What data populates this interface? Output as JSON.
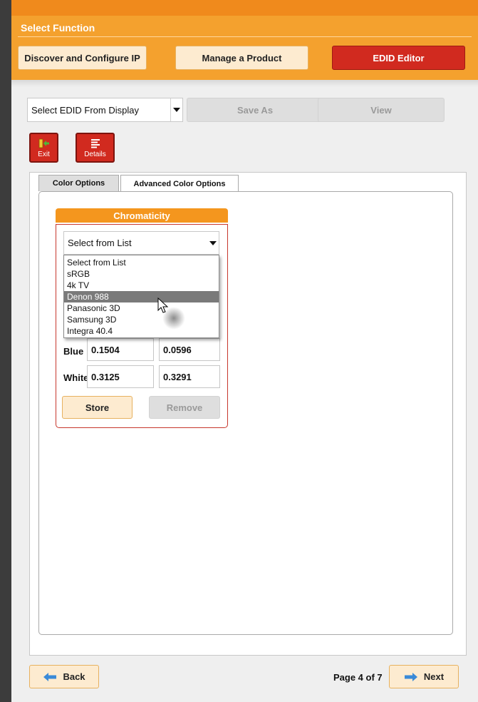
{
  "function_bar": {
    "title": "Select Function",
    "buttons": [
      {
        "label": "Discover and Configure IP",
        "active": false
      },
      {
        "label": "Manage a Product",
        "active": false
      },
      {
        "label": "EDID Editor",
        "active": true
      }
    ]
  },
  "toolbar": {
    "edid_select_value": "Select EDID From Display",
    "save_as_label": "Save As",
    "view_label": "View"
  },
  "actions": {
    "exit_label": "Exit",
    "details_label": "Details"
  },
  "tabs": [
    {
      "label": "Color Options",
      "active": false
    },
    {
      "label": "Advanced Color Options",
      "active": true
    }
  ],
  "chromaticity": {
    "title": "Chromaticity",
    "select_value": "Select from List",
    "dropdown_options": [
      "Select from List",
      "sRGB",
      "4k TV",
      "Denon 988",
      "Panasonic 3D",
      "Samsung 3D",
      "Integra 40.4"
    ],
    "highlighted_option": "Denon 988",
    "rows": [
      {
        "label": "Blue",
        "x": "0.1504",
        "y": "0.0596"
      },
      {
        "label": "White",
        "x": "0.3125",
        "y": "0.3291"
      }
    ],
    "store_label": "Store",
    "remove_label": "Remove"
  },
  "footer": {
    "back_label": "Back",
    "page_text": "Page 4 of 7",
    "next_label": "Next"
  },
  "colors": {
    "accent_orange": "#f4a12e",
    "active_red": "#d12a1f",
    "button_cream": "#fdebd0"
  }
}
